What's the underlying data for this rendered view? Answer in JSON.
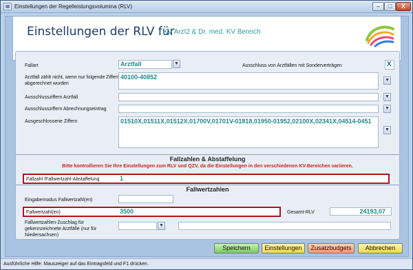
{
  "window": {
    "title": "Einstellungen der Regelleistungsvolumina (RLV)",
    "minimize_glyph": "–",
    "maximize_glyph": "□",
    "close_glyph": "X"
  },
  "header": {
    "title": "Einstellungen der RLV für",
    "subtitle": "KV Arzt2 & Dr. med. KV Bereich"
  },
  "form": {
    "fallart_label": "Fallart",
    "fallart_value": "Arztfall",
    "sondervertraege_label": "Ausschluss von Arztfällen mit Sonderverträgen",
    "sondervertraege_value": "X",
    "nicht_zaehlen_label": "Arztfall zählt nicht, wenn nur folgende Ziffern abgerechnet wurden",
    "nicht_zaehlen_value": "40100-40852",
    "ausschluss_arztfall_label": "Ausschlussziffern Arztfall",
    "ausschluss_abrechnung_label": "Ausschlussziffern Abrechnungseintrag",
    "ausgeschlossene_label": "Ausgeschlossene Ziffern",
    "ausgeschlossene_value": "01510X,01511X,01512X,01700V,01701V-01818,01950-01952,02100X,02341X,04514-0451"
  },
  "fallzahlen": {
    "header": "Fallzahlen & Abstaffelung",
    "warning": "Bitte kontrollieren Sie Ihre Einstellungen zum RLV und QZV, da die Einstellungen in den verschiedenen KV-Bereichen variieren.",
    "abstaffelung_label": "Fallzahl /Fallwertzahl-Abstaffelung",
    "abstaffelung_value": "1"
  },
  "fallwertzahlen": {
    "header": "Fallwertzahlen",
    "eingabemodus_label": "Eingabemodus Fallwertzahl(en)",
    "fallwertzahl_label": "Fallwertzahl(en)",
    "fallwertzahl_value": "3500",
    "gesamt_label": "Gesamt-RLV",
    "gesamt_value": "24193,07",
    "zuschlag_label": "Fallwertzahlen-Zuschlag für gekennzeichnete Arztfälle (nur für Niedersachsen)"
  },
  "buttons": {
    "save": "Speichern",
    "settings": "Einstellungen",
    "extra": "Zusatzbudgets",
    "cancel": "Abbrechen"
  },
  "status": {
    "text": "Ausführliche Hilfe: Mauszeiger auf das Eintragsfeld und F1 drücken."
  }
}
